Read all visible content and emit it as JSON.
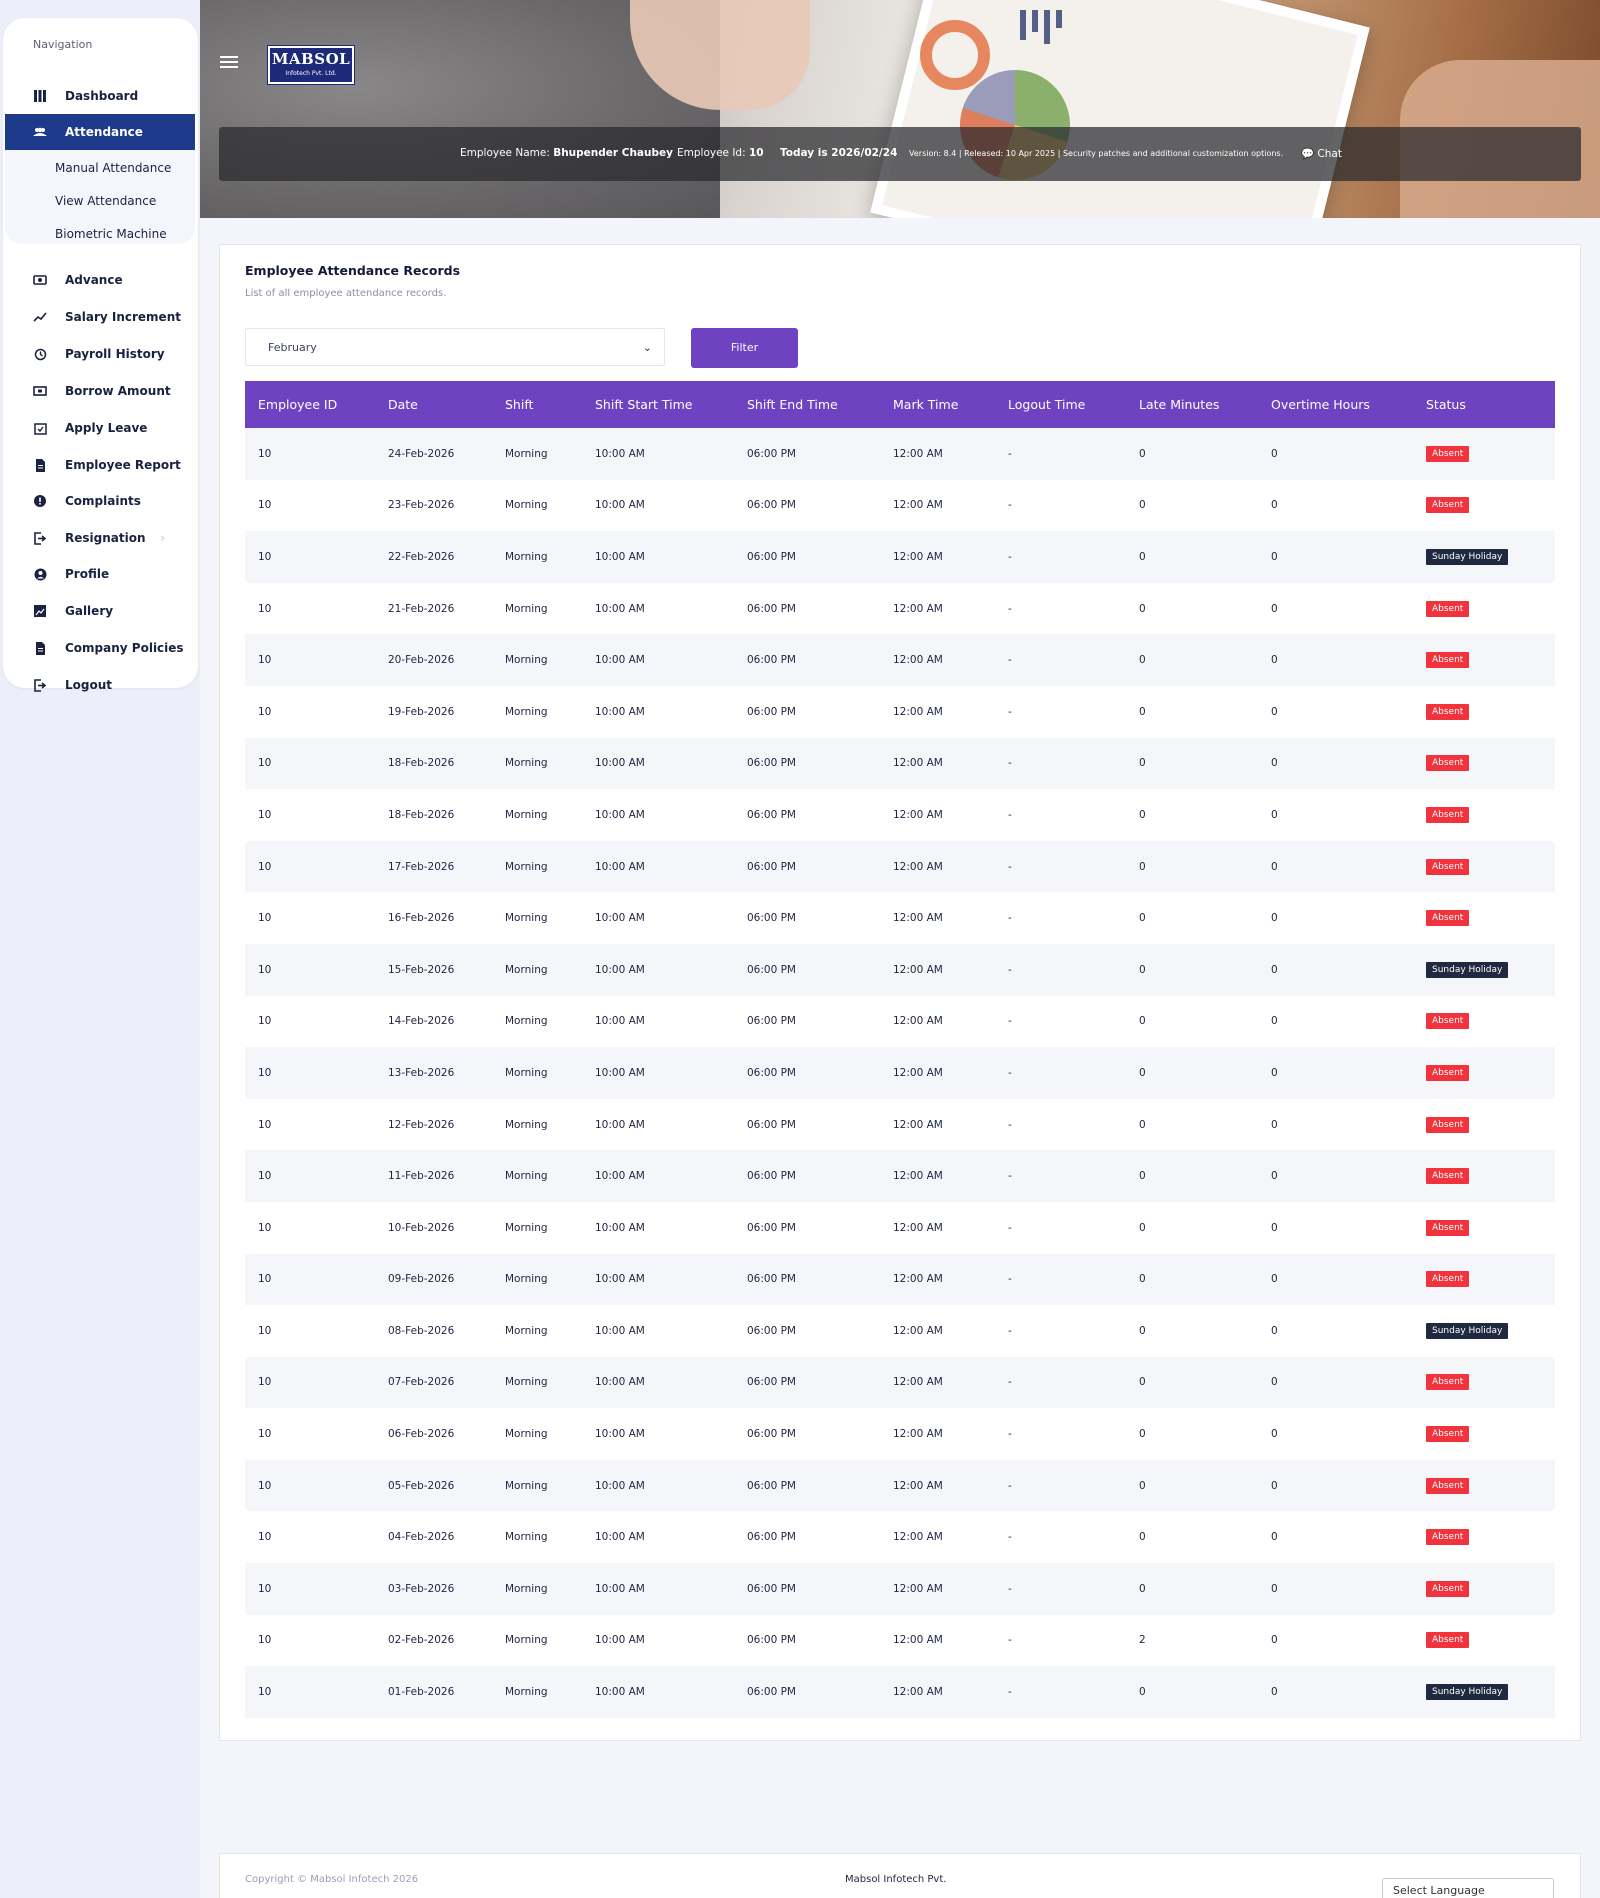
{
  "sidebar": {
    "heading": "Navigation",
    "items": [
      {
        "label": "Dashboard",
        "icon": "dashboard-icon"
      },
      {
        "label": "Attendance",
        "icon": "users-icon",
        "active": true
      },
      {
        "label": "Advance",
        "icon": "money-icon"
      },
      {
        "label": "Salary Increment",
        "icon": "trend-up-icon"
      },
      {
        "label": "Payroll History",
        "icon": "history-icon"
      },
      {
        "label": "Borrow Amount",
        "icon": "cash-icon"
      },
      {
        "label": "Apply Leave",
        "icon": "calendar-check-icon"
      },
      {
        "label": "Employee Report",
        "icon": "document-icon"
      },
      {
        "label": "Complaints",
        "icon": "alert-icon"
      },
      {
        "label": "Resignation",
        "icon": "exit-icon"
      },
      {
        "label": "Profile",
        "icon": "user-circle-icon"
      },
      {
        "label": "Gallery",
        "icon": "image-icon"
      },
      {
        "label": "Company Policies",
        "icon": "document-icon"
      },
      {
        "label": "Logout",
        "icon": "logout-icon"
      }
    ],
    "submenu": [
      "Manual Attendance",
      "View Attendance",
      "Biometric Machine"
    ]
  },
  "header": {
    "logo_main": "MABSOL",
    "logo_sub": "Infotech Pvt. Ltd.",
    "employee_name_label": "Employee Name:",
    "employee_name": "Bhupender Chaubey",
    "employee_id_label": "Employee Id:",
    "employee_id": "10",
    "today": "Today is 2026/02/24",
    "version": "Version: 8.4 | Released: 10 Apr 2025 | Security patches and additional customization options.",
    "chat": "Chat"
  },
  "card": {
    "title": "Employee Attendance Records",
    "subtitle": "List of all employee attendance records.",
    "month_selected": "February",
    "filter_label": "Filter"
  },
  "table": {
    "columns": [
      "Employee ID",
      "Date",
      "Shift",
      "Shift Start Time",
      "Shift End Time",
      "Mark Time",
      "Logout Time",
      "Late Minutes",
      "Overtime Hours",
      "Status"
    ],
    "rows": [
      [
        "10",
        "24-Feb-2026",
        "Morning",
        "10:00 AM",
        "06:00 PM",
        "12:00 AM",
        "-",
        "0",
        "0",
        "Absent"
      ],
      [
        "10",
        "23-Feb-2026",
        "Morning",
        "10:00 AM",
        "06:00 PM",
        "12:00 AM",
        "-",
        "0",
        "0",
        "Absent"
      ],
      [
        "10",
        "22-Feb-2026",
        "Morning",
        "10:00 AM",
        "06:00 PM",
        "12:00 AM",
        "-",
        "0",
        "0",
        "Sunday Holiday"
      ],
      [
        "10",
        "21-Feb-2026",
        "Morning",
        "10:00 AM",
        "06:00 PM",
        "12:00 AM",
        "-",
        "0",
        "0",
        "Absent"
      ],
      [
        "10",
        "20-Feb-2026",
        "Morning",
        "10:00 AM",
        "06:00 PM",
        "12:00 AM",
        "-",
        "0",
        "0",
        "Absent"
      ],
      [
        "10",
        "19-Feb-2026",
        "Morning",
        "10:00 AM",
        "06:00 PM",
        "12:00 AM",
        "-",
        "0",
        "0",
        "Absent"
      ],
      [
        "10",
        "18-Feb-2026",
        "Morning",
        "10:00 AM",
        "06:00 PM",
        "12:00 AM",
        "-",
        "0",
        "0",
        "Absent"
      ],
      [
        "10",
        "18-Feb-2026",
        "Morning",
        "10:00 AM",
        "06:00 PM",
        "12:00 AM",
        "-",
        "0",
        "0",
        "Absent"
      ],
      [
        "10",
        "17-Feb-2026",
        "Morning",
        "10:00 AM",
        "06:00 PM",
        "12:00 AM",
        "-",
        "0",
        "0",
        "Absent"
      ],
      [
        "10",
        "16-Feb-2026",
        "Morning",
        "10:00 AM",
        "06:00 PM",
        "12:00 AM",
        "-",
        "0",
        "0",
        "Absent"
      ],
      [
        "10",
        "15-Feb-2026",
        "Morning",
        "10:00 AM",
        "06:00 PM",
        "12:00 AM",
        "-",
        "0",
        "0",
        "Sunday Holiday"
      ],
      [
        "10",
        "14-Feb-2026",
        "Morning",
        "10:00 AM",
        "06:00 PM",
        "12:00 AM",
        "-",
        "0",
        "0",
        "Absent"
      ],
      [
        "10",
        "13-Feb-2026",
        "Morning",
        "10:00 AM",
        "06:00 PM",
        "12:00 AM",
        "-",
        "0",
        "0",
        "Absent"
      ],
      [
        "10",
        "12-Feb-2026",
        "Morning",
        "10:00 AM",
        "06:00 PM",
        "12:00 AM",
        "-",
        "0",
        "0",
        "Absent"
      ],
      [
        "10",
        "11-Feb-2026",
        "Morning",
        "10:00 AM",
        "06:00 PM",
        "12:00 AM",
        "-",
        "0",
        "0",
        "Absent"
      ],
      [
        "10",
        "10-Feb-2026",
        "Morning",
        "10:00 AM",
        "06:00 PM",
        "12:00 AM",
        "-",
        "0",
        "0",
        "Absent"
      ],
      [
        "10",
        "09-Feb-2026",
        "Morning",
        "10:00 AM",
        "06:00 PM",
        "12:00 AM",
        "-",
        "0",
        "0",
        "Absent"
      ],
      [
        "10",
        "08-Feb-2026",
        "Morning",
        "10:00 AM",
        "06:00 PM",
        "12:00 AM",
        "-",
        "0",
        "0",
        "Sunday Holiday"
      ],
      [
        "10",
        "07-Feb-2026",
        "Morning",
        "10:00 AM",
        "06:00 PM",
        "12:00 AM",
        "-",
        "0",
        "0",
        "Absent"
      ],
      [
        "10",
        "06-Feb-2026",
        "Morning",
        "10:00 AM",
        "06:00 PM",
        "12:00 AM",
        "-",
        "0",
        "0",
        "Absent"
      ],
      [
        "10",
        "05-Feb-2026",
        "Morning",
        "10:00 AM",
        "06:00 PM",
        "12:00 AM",
        "-",
        "0",
        "0",
        "Absent"
      ],
      [
        "10",
        "04-Feb-2026",
        "Morning",
        "10:00 AM",
        "06:00 PM",
        "12:00 AM",
        "-",
        "0",
        "0",
        "Absent"
      ],
      [
        "10",
        "03-Feb-2026",
        "Morning",
        "10:00 AM",
        "06:00 PM",
        "12:00 AM",
        "-",
        "0",
        "0",
        "Absent"
      ],
      [
        "10",
        "02-Feb-2026",
        "Morning",
        "10:00 AM",
        "06:00 PM",
        "12:00 AM",
        "-",
        "2",
        "0",
        "Absent"
      ],
      [
        "10",
        "01-Feb-2026",
        "Morning",
        "10:00 AM",
        "06:00 PM",
        "12:00 AM",
        "-",
        "0",
        "0",
        "Sunday Holiday"
      ]
    ]
  },
  "footer": {
    "copyright": "Copyright © Mabsol Infotech 2026",
    "company": "Mabsol Infotech Pvt.",
    "language_select": "Select Language"
  },
  "colors": {
    "accent_purple": "#6f42c1",
    "active_nav": "#1e3a8a",
    "absent_badge": "#f0333d",
    "holiday_badge": "#1f2a40"
  }
}
